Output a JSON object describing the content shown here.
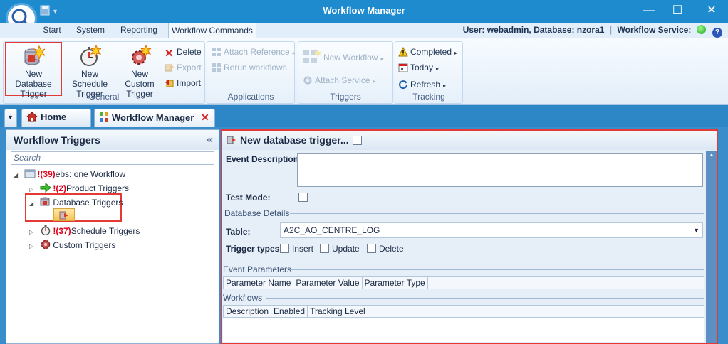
{
  "window": {
    "title": "Workflow Manager",
    "min": "—",
    "max": "☐",
    "close": "✕"
  },
  "ribbon_tabs": [
    "Start",
    "System",
    "Reporting",
    "Workflow Commands"
  ],
  "user_info": {
    "text": "User: webadmin, Database: nzora1",
    "service_label": "Workflow Service:",
    "help": "?"
  },
  "ribbon": {
    "general": {
      "label": "General",
      "new_db_trigger": "New Database Trigger",
      "new_schedule_trigger": "New Schedule Trigger",
      "new_custom_trigger": "New Custom Trigger",
      "delete": "Delete",
      "export": "Export",
      "import": "Import"
    },
    "applications": {
      "label": "Applications",
      "attach_reference": "Attach Reference",
      "rerun_workflows": "Rerun workflows"
    },
    "triggers": {
      "label": "Triggers",
      "new_workflow": "New Workflow",
      "attach_service": "Attach Service"
    },
    "tracking": {
      "label": "Tracking",
      "completed": "Completed",
      "today": "Today",
      "refresh": "Refresh"
    }
  },
  "doc_tabs": {
    "home": "Home",
    "workflow_manager": "Workflow Manager"
  },
  "left_panel": {
    "title": "Workflow Triggers",
    "collapse": "«",
    "search_placeholder": "Search",
    "tree": {
      "root": {
        "count": "!(39)",
        "label": "ebs: one Workflow"
      },
      "product": {
        "count": "!(2)",
        "label": "Product Triggers"
      },
      "database": {
        "label": "Database Triggers"
      },
      "schedule": {
        "count": "!(37)",
        "label": "Schedule Triggers"
      },
      "custom": {
        "label": "Custom Triggers"
      }
    }
  },
  "right_panel": {
    "title": "New database trigger...",
    "event_description_label": "Event Description:",
    "test_mode_label": "Test Mode:",
    "database_details_label": "Database Details",
    "table_label": "Table:",
    "table_value": "A2C_AO_CENTRE_LOG",
    "trigger_types_label": "Trigger types:",
    "trigger_types": [
      "Insert",
      "Update",
      "Delete"
    ],
    "event_parameters_label": "Event Parameters",
    "param_columns": [
      "Parameter Name",
      "Parameter Value",
      "Parameter Type"
    ],
    "workflows_label": "Workflows",
    "workflow_columns": [
      "Description",
      "Enabled",
      "Tracking Level"
    ]
  }
}
